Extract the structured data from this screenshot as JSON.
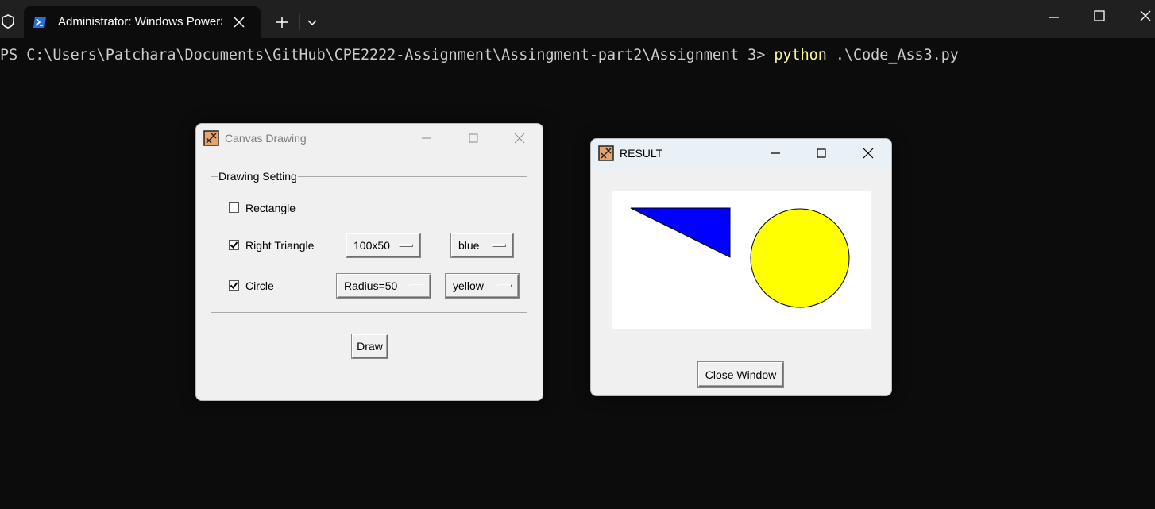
{
  "terminal": {
    "tab_title": "Administrator: Windows PowerShell",
    "prompt": "PS C:\\Users\\Patchara\\Documents\\GitHub\\CPE2222-Assignment\\Assingment-part2\\Assignment 3> ",
    "command": "python",
    "argument": " .\\Code_Ass3.py"
  },
  "drawing_window": {
    "title": "Canvas Drawing",
    "frame_label": "Drawing Setting",
    "shapes": [
      {
        "label": "Rectangle",
        "checked": false
      },
      {
        "label": "Right Triangle",
        "checked": true,
        "size": "100x50",
        "color": "blue"
      },
      {
        "label": "Circle",
        "checked": true,
        "size": "Radius=50",
        "color": "yellow"
      }
    ],
    "draw_button": "Draw"
  },
  "result_window": {
    "title": "RESULT",
    "close_button": "Close Window",
    "shapes": {
      "triangle": {
        "fill": "#0000ff",
        "size": "100x50"
      },
      "circle": {
        "fill": "#ffff00",
        "radius": 50
      }
    }
  },
  "colors": {
    "terminal_bg": "#0c0c0c",
    "terminal_text": "#cccccc",
    "command_text": "#f9f1a5",
    "tab_bar": "#202020",
    "tk_bg": "#f0f0f0"
  }
}
